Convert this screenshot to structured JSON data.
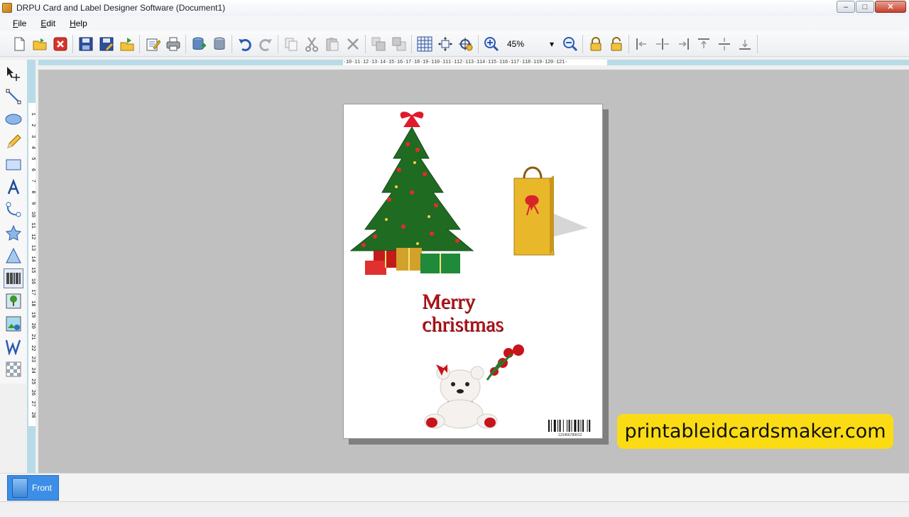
{
  "window": {
    "title": "DRPU Card and Label Designer Software  (Document1)",
    "minimize": "–",
    "maximize": "□",
    "close": "✕"
  },
  "menu": {
    "items": [
      "File",
      "Edit",
      "Help"
    ]
  },
  "toolbar": {
    "zoom": {
      "value": "45%",
      "arrow": "▾"
    },
    "buttons": [
      "new-icon",
      "open-icon",
      "close-document-icon",
      "save-icon",
      "save-as-icon",
      "export-icon",
      "properties-icon",
      "print-icon",
      "database-add-icon",
      "database-icon",
      "undo-icon",
      "redo-icon",
      "copy-icon",
      "cut-icon",
      "paste-icon",
      "delete-icon",
      "bring-front-icon",
      "send-back-icon",
      "grid-icon",
      "fit-icon",
      "center-icon",
      "zoom-in-icon",
      "zoom-out-icon",
      "lock-icon",
      "unlock-icon",
      "align-left-icon",
      "align-center-icon",
      "align-right-icon",
      "align-top-icon",
      "align-middle-icon",
      "align-bottom-icon"
    ]
  },
  "tools": [
    "pointer-tool-icon",
    "line-tool-icon",
    "ellipse-tool-icon",
    "pencil-tool-icon",
    "rectangle-tool-icon",
    "text-tool-icon",
    "curve-tool-icon",
    "star-tool-icon",
    "triangle-tool-icon",
    "barcode-tool-icon",
    "picture-tool-icon",
    "image-library-icon",
    "wordart-tool-icon",
    "background-tool-icon"
  ],
  "ruler": {
    "horizontal": "·10·11·12·13·14·15·16·17·18·19·110·111·112·113·114·115·116·117·118·119·120·121·",
    "vertical": [
      "1",
      "2",
      "3",
      "4",
      "5",
      "6",
      "7",
      "8",
      "9",
      "10",
      "11",
      "12",
      "13",
      "14",
      "15",
      "16",
      "17",
      "18",
      "19",
      "20",
      "21",
      "22",
      "23",
      "24",
      "25",
      "26",
      "27",
      "28"
    ]
  },
  "card": {
    "greeting_line1": "Merry",
    "greeting_line2": "christmas",
    "barcode_number": "123456789012",
    "accent_red": "#c0141c"
  },
  "brand": {
    "text": "printableidcardsmaker.com",
    "color": "#fbdc14"
  },
  "pages": {
    "front_tab": "Front"
  }
}
